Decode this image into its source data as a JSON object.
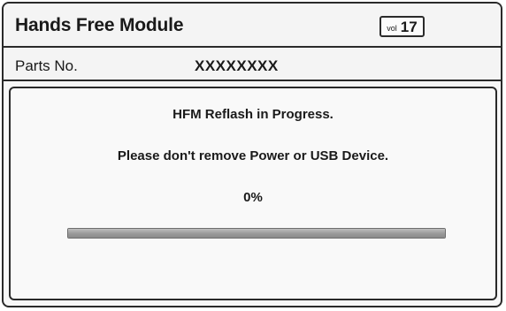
{
  "header": {
    "title": "Hands Free Module",
    "vol_label": "vol",
    "vol_value": "17"
  },
  "parts": {
    "label": "Parts No.",
    "value": "XXXXXXXX"
  },
  "status": {
    "heading": "HFM Reflash in Progress.",
    "warning": "Please don't remove Power or USB Device.",
    "percent_text": "0%",
    "progress_fraction": 0
  }
}
